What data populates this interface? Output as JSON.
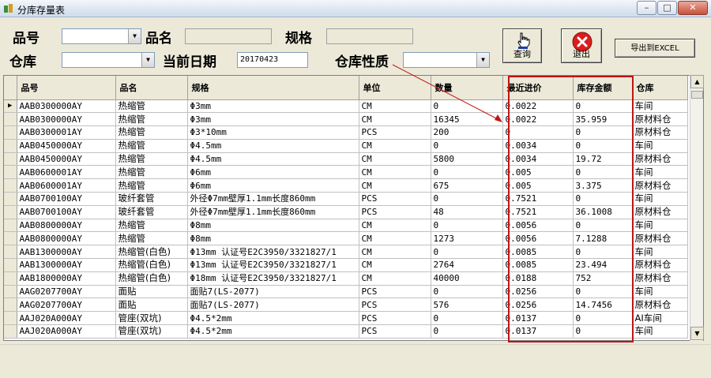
{
  "window": {
    "title": "分库存量表"
  },
  "filters": {
    "part_no_label": "品号",
    "part_no_value": "",
    "name_label": "品名",
    "name_value": "",
    "spec_label": "规格",
    "spec_value": "",
    "warehouse_label": "仓库",
    "warehouse_value": "",
    "date_label": "当前日期",
    "date_value": "20170423",
    "nature_label": "仓库性质",
    "nature_value": ""
  },
  "buttons": {
    "query": "查询",
    "exit": "退出",
    "export": "导出到EXCEL"
  },
  "colors": {
    "highlight_box": "#c01515",
    "exit_icon": "#d81e1e"
  },
  "table": {
    "columns": [
      "品号",
      "品名",
      "规格",
      "单位",
      "数量",
      "最近进价",
      "库存金额",
      "仓库"
    ],
    "rows": [
      [
        "AAB0300000AY",
        "热缩管",
        "Φ3mm",
        "CM",
        "0",
        "0.0022",
        "0",
        "车间"
      ],
      [
        "AAB0300000AY",
        "热缩管",
        "Φ3mm",
        "CM",
        "16345",
        "0.0022",
        "35.959",
        "原材料仓"
      ],
      [
        "AAB0300001AY",
        "热缩管",
        "Φ3*10mm",
        "PCS",
        "200",
        "0",
        "0",
        "原材料仓"
      ],
      [
        "AAB0450000AY",
        "热缩管",
        "Φ4.5mm",
        "CM",
        "0",
        "0.0034",
        "0",
        "车间"
      ],
      [
        "AAB0450000AY",
        "热缩管",
        "Φ4.5mm",
        "CM",
        "5800",
        "0.0034",
        "19.72",
        "原材料仓"
      ],
      [
        "AAB0600001AY",
        "热缩管",
        "Φ6mm",
        "CM",
        "0",
        "0.005",
        "0",
        "车间"
      ],
      [
        "AAB0600001AY",
        "热缩管",
        "Φ6mm",
        "CM",
        "675",
        "0.005",
        "3.375",
        "原材料仓"
      ],
      [
        "AAB0700100AY",
        "玻纤套管",
        "外径Φ7mm壁厚1.1mm长度860mm",
        "PCS",
        "0",
        "0.7521",
        "0",
        "车间"
      ],
      [
        "AAB0700100AY",
        "玻纤套管",
        "外径Φ7mm壁厚1.1mm长度860mm",
        "PCS",
        "48",
        "0.7521",
        "36.1008",
        "原材料仓"
      ],
      [
        "AAB0800000AY",
        "热缩管",
        "Φ8mm",
        "CM",
        "0",
        "0.0056",
        "0",
        "车间"
      ],
      [
        "AAB0800000AY",
        "热缩管",
        "Φ8mm",
        "CM",
        "1273",
        "0.0056",
        "7.1288",
        "原材料仓"
      ],
      [
        "AAB1300000AY",
        "热缩管(白色)",
        "Φ13mm 认证号E2C3950/3321827/1",
        "CM",
        "0",
        "0.0085",
        "0",
        "车间"
      ],
      [
        "AAB1300000AY",
        "热缩管(白色)",
        "Φ13mm 认证号E2C3950/3321827/1",
        "CM",
        "2764",
        "0.0085",
        "23.494",
        "原材料仓"
      ],
      [
        "AAB1800000AY",
        "热缩管(白色)",
        "Φ18mm 认证号E2C3950/3321827/1",
        "CM",
        "40000",
        "0.0188",
        "752",
        "原材料仓"
      ],
      [
        "AAG0207700AY",
        "面贴",
        "面贴7(LS-2077)",
        "PCS",
        "0",
        "0.0256",
        "0",
        "车间"
      ],
      [
        "AAG0207700AY",
        "面贴",
        "面贴7(LS-2077)",
        "PCS",
        "576",
        "0.0256",
        "14.7456",
        "原材料仓"
      ],
      [
        "AAJ020A000AY",
        "管座(双坑)",
        "Φ4.5*2mm",
        "PCS",
        "0",
        "0.0137",
        "0",
        "AI车间"
      ],
      [
        "AAJ020A000AY",
        "管座(双坑)",
        "Φ4.5*2mm",
        "PCS",
        "0",
        "0.0137",
        "0",
        "车间"
      ]
    ]
  }
}
